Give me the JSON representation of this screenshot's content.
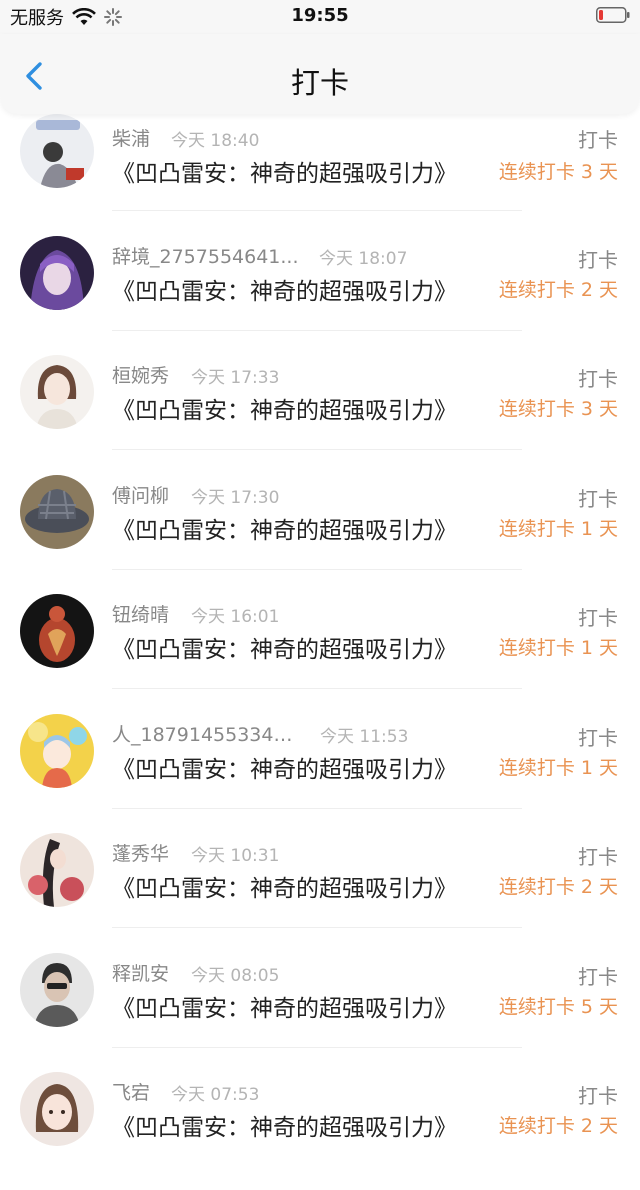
{
  "status_bar": {
    "carrier": "无服务",
    "time": "19:55",
    "icons": [
      "wifi-icon",
      "loading-spinner-icon",
      "battery-low-icon"
    ],
    "battery_color": "#e53935"
  },
  "nav": {
    "title": "打卡",
    "back_icon": "chevron-left-icon",
    "accent_color": "#2f8fe0"
  },
  "records": [
    {
      "name": "柴浦",
      "time": "今天 18:40",
      "book": "《凹凸雷安：神奇的超强吸引力》",
      "action": "打卡",
      "streak": "连续打卡 3 天"
    },
    {
      "name": "辞境_2757554641...",
      "time": "今天 18:07",
      "book": "《凹凸雷安：神奇的超强吸引力》",
      "action": "打卡",
      "streak": "连续打卡 2 天"
    },
    {
      "name": "桓婉秀",
      "time": "今天 17:33",
      "book": "《凹凸雷安：神奇的超强吸引力》",
      "action": "打卡",
      "streak": "连续打卡 3 天"
    },
    {
      "name": "傅问柳",
      "time": "今天 17:30",
      "book": "《凹凸雷安：神奇的超强吸引力》",
      "action": "打卡",
      "streak": "连续打卡 1 天"
    },
    {
      "name": "钮绮晴",
      "time": "今天 16:01",
      "book": "《凹凸雷安：神奇的超强吸引力》",
      "action": "打卡",
      "streak": "连续打卡 1 天"
    },
    {
      "name": "人_187914553344...",
      "time": "今天 11:53",
      "book": "《凹凸雷安：神奇的超强吸引力》",
      "action": "打卡",
      "streak": "连续打卡 1 天"
    },
    {
      "name": "蓬秀华",
      "time": "今天 10:31",
      "book": "《凹凸雷安：神奇的超强吸引力》",
      "action": "打卡",
      "streak": "连续打卡 2 天"
    },
    {
      "name": "释凯安",
      "time": "今天 08:05",
      "book": "《凹凸雷安：神奇的超强吸引力》",
      "action": "打卡",
      "streak": "连续打卡 5 天"
    },
    {
      "name": "飞宕",
      "time": "今天 07:53",
      "book": "《凹凸雷安：神奇的超强吸引力》",
      "action": "打卡",
      "streak": "连续打卡 2 天"
    }
  ],
  "colors": {
    "streak": "#e99352",
    "name": "#888888",
    "time": "#b4b4b4"
  }
}
